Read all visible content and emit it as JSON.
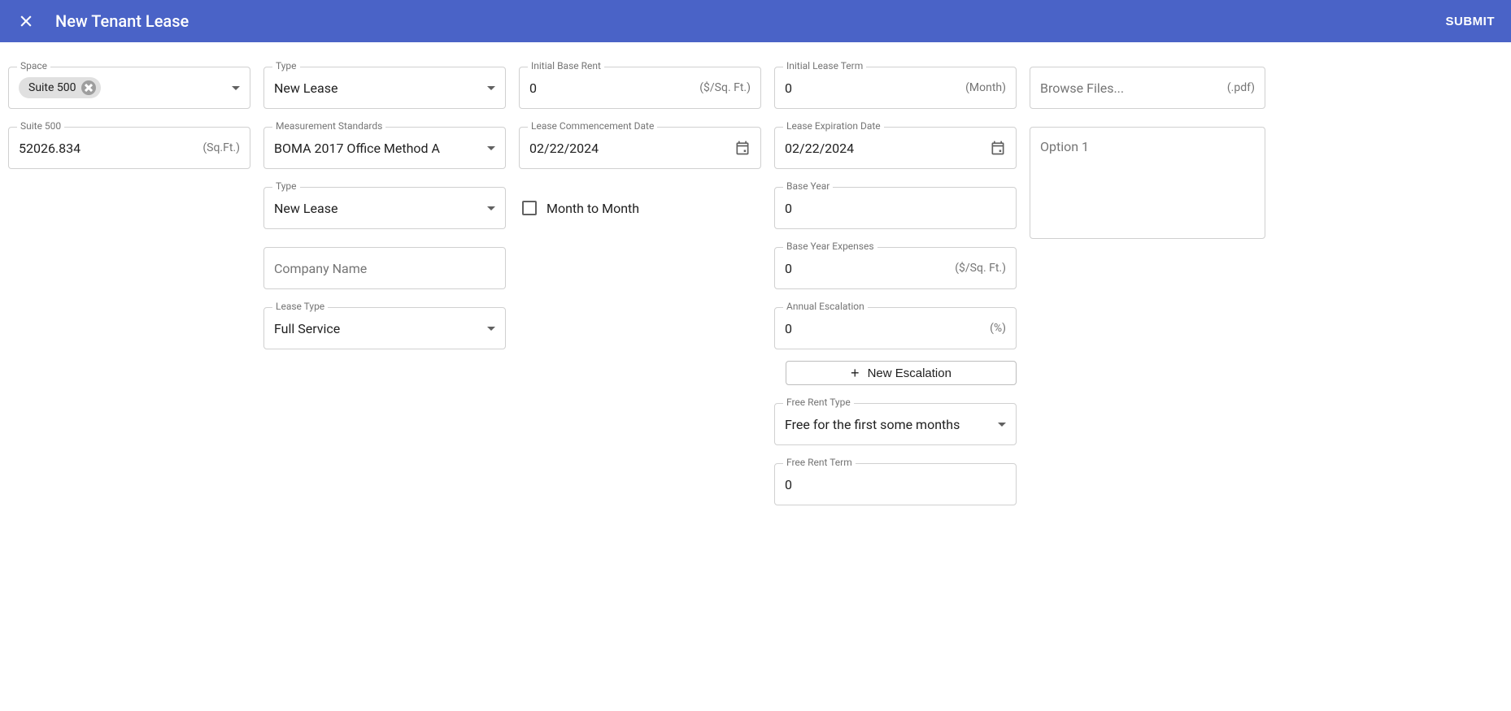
{
  "header": {
    "title": "New Tenant Lease",
    "submit_label": "SUBMIT"
  },
  "col1": {
    "space_label": "Space",
    "space_chip": "Suite 500",
    "suite_label": "Suite 500",
    "suite_value": "52026.834",
    "suite_suffix": "(Sq.Ft.)"
  },
  "col2": {
    "type1_label": "Type",
    "type1_value": "New Lease",
    "measurement_label": "Measurement Standards",
    "measurement_value": "BOMA 2017 Office Method A",
    "type2_label": "Type",
    "type2_value": "New Lease",
    "company_placeholder": "Company Name",
    "leasetype_label": "Lease Type",
    "leasetype_value": "Full Service"
  },
  "col3": {
    "initial_base_rent_label": "Initial Base Rent",
    "initial_base_rent_value": "0",
    "initial_base_rent_suffix": "($/Sq. Ft.)",
    "commence_label": "Lease Commencement Date",
    "commence_value": "02/22/2024",
    "month_to_month_label": "Month to Month"
  },
  "col4": {
    "initial_term_label": "Initial Lease Term",
    "initial_term_value": "0",
    "initial_term_suffix": "(Month)",
    "expiration_label": "Lease Expiration Date",
    "expiration_value": "02/22/2024",
    "base_year_label": "Base Year",
    "base_year_value": "0",
    "base_year_exp_label": "Base Year Expenses",
    "base_year_exp_value": "0",
    "base_year_exp_suffix": "($/Sq. Ft.)",
    "annual_esc_label": "Annual Escalation",
    "annual_esc_value": "0",
    "annual_esc_suffix": "(%)",
    "new_escalation_label": "New Escalation",
    "free_rent_type_label": "Free Rent Type",
    "free_rent_type_value": "Free for the first some months",
    "free_rent_term_label": "Free Rent Term",
    "free_rent_term_value": "0"
  },
  "col5": {
    "browse_label": "Browse Files...",
    "browse_suffix": "(.pdf)",
    "option_text": "Option 1"
  }
}
